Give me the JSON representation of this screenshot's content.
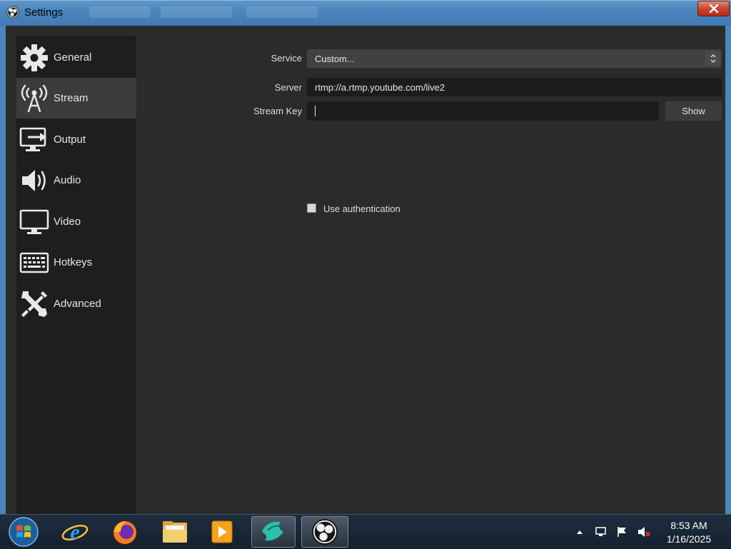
{
  "window": {
    "title": "Settings"
  },
  "sidebar": {
    "items": [
      {
        "label": "General",
        "icon": "gear-icon"
      },
      {
        "label": "Stream",
        "icon": "broadcast-tower-icon"
      },
      {
        "label": "Output",
        "icon": "monitor-output-icon"
      },
      {
        "label": "Audio",
        "icon": "speaker-icon"
      },
      {
        "label": "Video",
        "icon": "monitor-icon"
      },
      {
        "label": "Hotkeys",
        "icon": "keyboard-icon"
      },
      {
        "label": "Advanced",
        "icon": "wrench-screwdriver-icon"
      }
    ],
    "active_index": 1
  },
  "stream": {
    "service_label": "Service",
    "service_value": "Custom...",
    "server_label": "Server",
    "server_value": "rtmp://a.rtmp.youtube.com/live2",
    "stream_key_label": "Stream Key",
    "stream_key_value": "",
    "show_button": "Show",
    "use_auth_label": "Use authentication",
    "use_auth_checked": false
  },
  "taskbar": {
    "apps": [
      "start-orb-icon",
      "internet-explorer-icon",
      "firefox-icon",
      "file-explorer-icon",
      "media-player-icon",
      "app-icon",
      "obs-icon"
    ],
    "time": "8:53 AM",
    "date": "1/16/2025"
  },
  "colors": {
    "background": "#2b2b2b",
    "sidebar": "#1e1e1e",
    "active_item": "#3b3b3b",
    "field": "#1c1c1c",
    "titlebar": "#4a86bd",
    "close": "#c9442f"
  }
}
